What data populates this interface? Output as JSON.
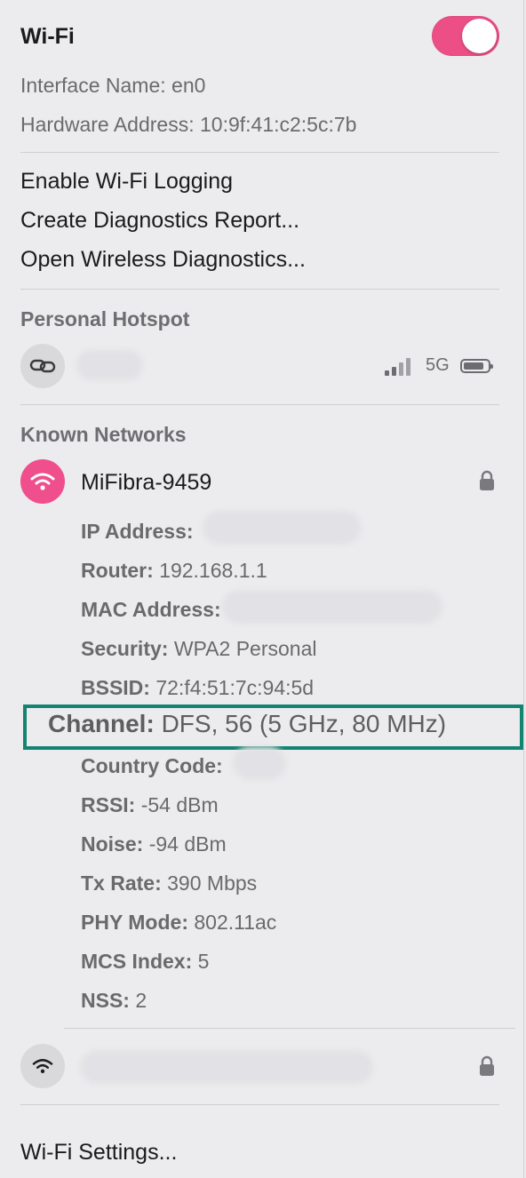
{
  "header": {
    "title": "Wi-Fi",
    "toggle_on": true,
    "toggle_color": "#ec4f86"
  },
  "interface": {
    "name_label": "Interface Name:",
    "name_value": "en0",
    "hw_label": "Hardware Address:",
    "hw_value": "10:9f:41:c2:5c:7b"
  },
  "actions": [
    "Enable Wi-Fi Logging",
    "Create Diagnostics Report...",
    "Open Wireless Diagnostics..."
  ],
  "hotspot": {
    "section_title": "Personal Hotspot",
    "icon": "link-icon",
    "signal": "signal-bars-icon",
    "network_type": "5G",
    "battery_icon": "battery-icon"
  },
  "known": {
    "section_title": "Known Networks",
    "network": {
      "name": "MiFibra-9459",
      "icon": "wifi-icon",
      "icon_color": "#ef4f8c",
      "lock_icon": "lock-icon",
      "details": [
        {
          "label": "IP Address:",
          "value": ""
        },
        {
          "label": "Router:",
          "value": "192.168.1.1"
        },
        {
          "label": "MAC Address:",
          "value": ""
        },
        {
          "label": "Security:",
          "value": "WPA2 Personal"
        },
        {
          "label": "BSSID:",
          "value": "72:f4:51:7c:94:5d"
        }
      ],
      "channel": {
        "label": "Channel:",
        "value": "DFS, 56 (5 GHz, 80 MHz)"
      },
      "details2": [
        {
          "label": "Country Code:",
          "value": ""
        },
        {
          "label": "RSSI:",
          "value": "-54 dBm"
        },
        {
          "label": "Noise:",
          "value": "-94 dBm"
        },
        {
          "label": "Tx Rate:",
          "value": "390 Mbps"
        },
        {
          "label": "PHY Mode:",
          "value": "802.11ac"
        },
        {
          "label": "MCS Index:",
          "value": "5"
        },
        {
          "label": "NSS:",
          "value": "2"
        }
      ]
    },
    "other_network": {
      "icon": "wifi-icon",
      "lock_icon": "lock-icon"
    }
  },
  "footer": {
    "settings_label": "Wi-Fi Settings..."
  },
  "highlight_color": "#138472"
}
